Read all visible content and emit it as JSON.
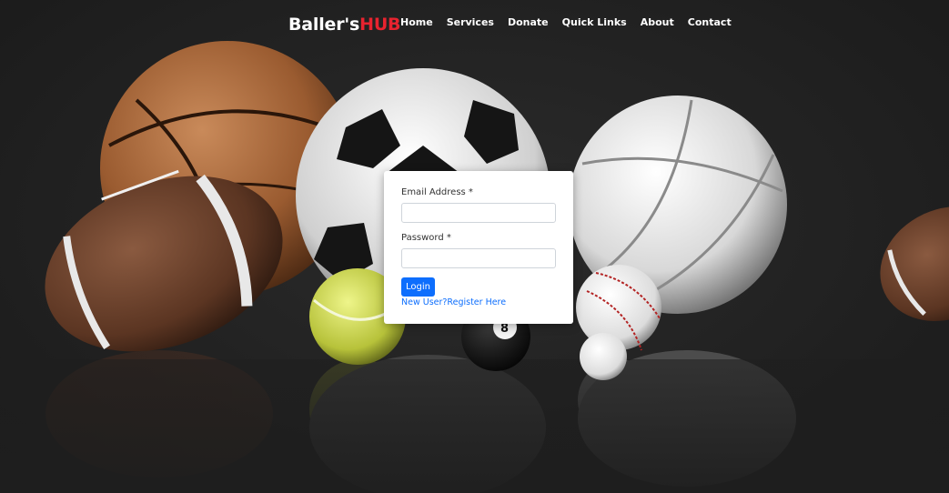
{
  "brand": {
    "name_part1": "Baller's",
    "name_part2": "HUB"
  },
  "nav": {
    "links": [
      "Home",
      "Services",
      "Donate",
      "Quick Links",
      "About",
      "Contact"
    ]
  },
  "login": {
    "email_label": "Email Address *",
    "email_value": "",
    "password_label": "Password *",
    "password_value": "",
    "submit_label": "Login",
    "register_text": "New User?Register Here"
  },
  "colors": {
    "brand_accent": "#e8232f",
    "button": "#0d6efd",
    "link": "#0d6efd",
    "background": "#262626"
  },
  "background_image": {
    "icon": "sports-balls-photo"
  }
}
